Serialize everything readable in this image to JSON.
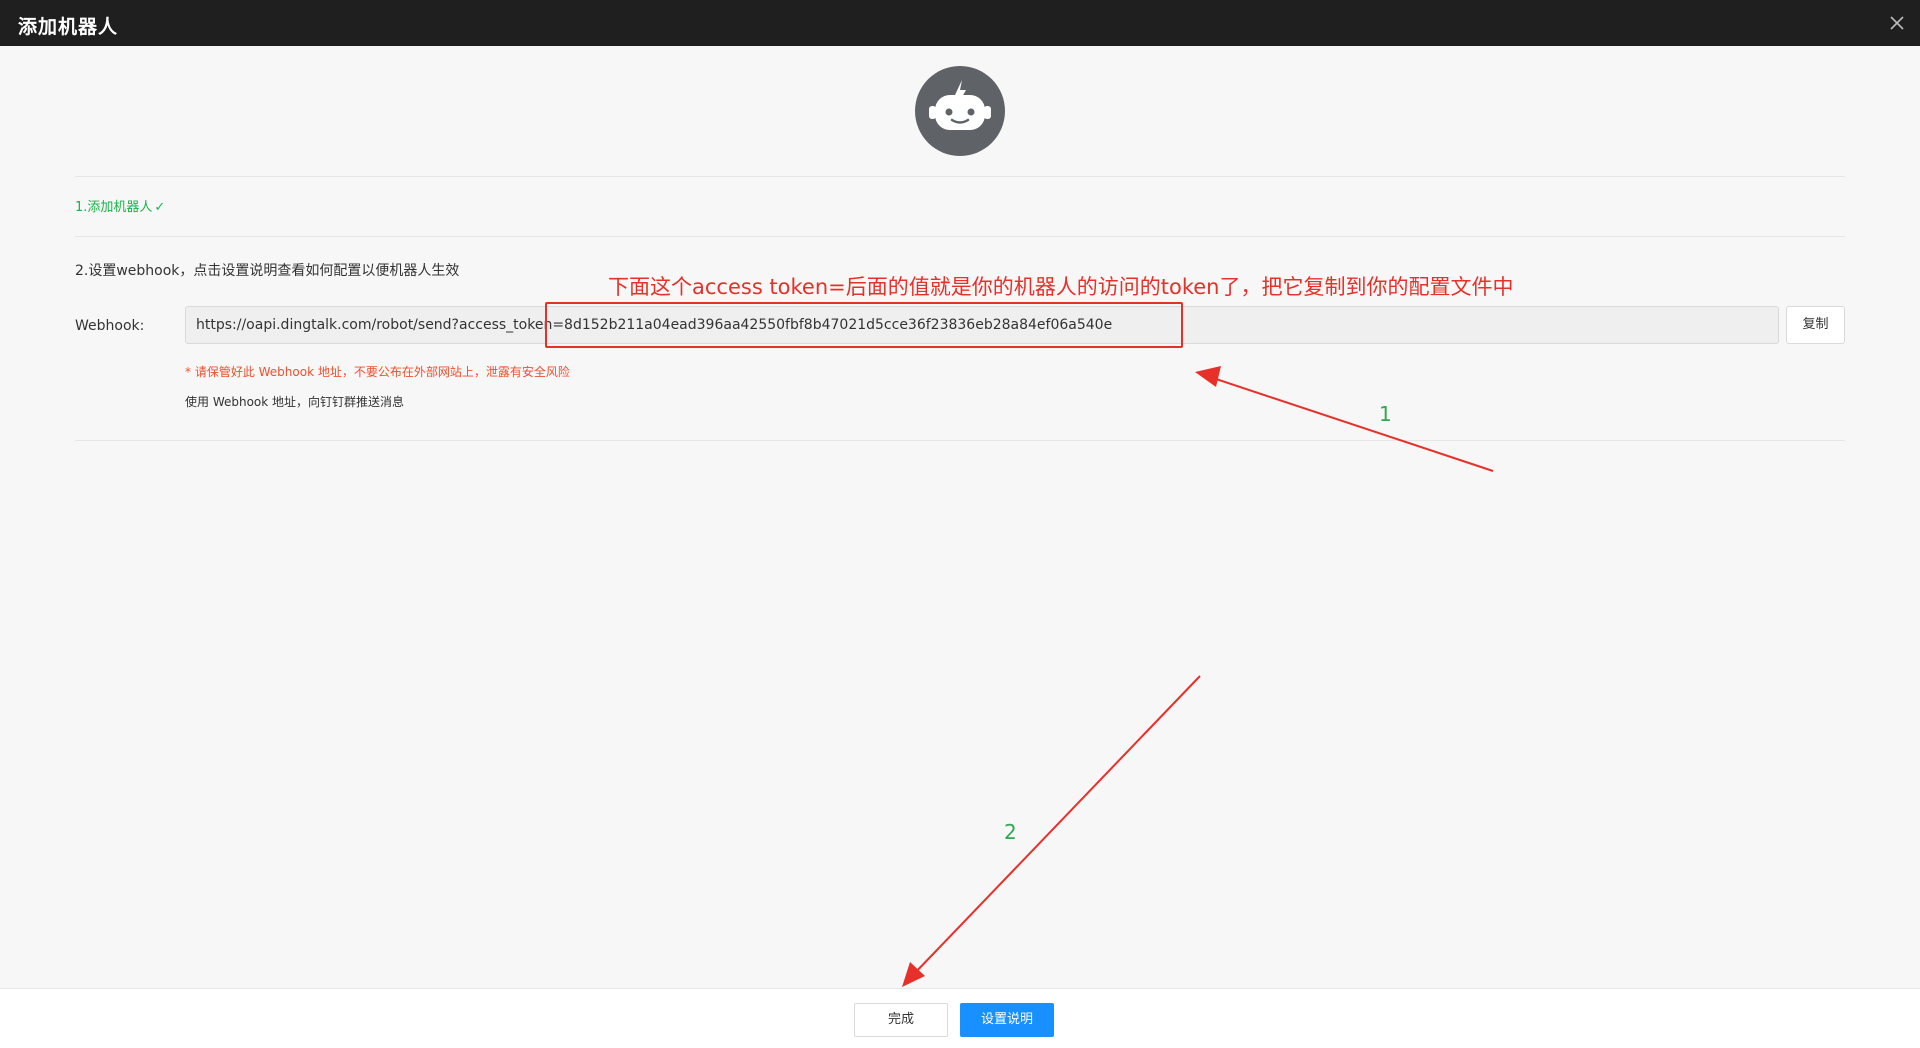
{
  "window": {
    "title": "添加机器人",
    "close_icon": "close-icon"
  },
  "avatar": {
    "icon": "robot-icon",
    "bg_color": "#5f6368"
  },
  "steps": {
    "step1_label": "1.添加机器人",
    "step1_check": "✓",
    "step2_label": "2.设置webhook，点击设置说明查看如何配置以便机器人生效"
  },
  "webhook": {
    "label": "Webhook:",
    "value": "https://oapi.dingtalk.com/robot/send?access_token=8d152b211a04ead396aa42550fbf8b47021d5cce36f23836eb28a84ef06a540e",
    "copy_label": "复制",
    "warning": "* 请保管好此 Webhook 地址，不要公布在外部网站上，泄露有安全风险",
    "usage": "使用 Webhook 地址，向钉钉群推送消息"
  },
  "annotations": {
    "main_text": "下面这个access token=后面的值就是你的机器人的访问的token了，把它复制到你的配置文件中",
    "marker1": "1",
    "marker2": "2",
    "color": "#e8302a"
  },
  "footer": {
    "done_label": "完成",
    "help_label": "设置说明",
    "primary_color": "#1890ff"
  }
}
